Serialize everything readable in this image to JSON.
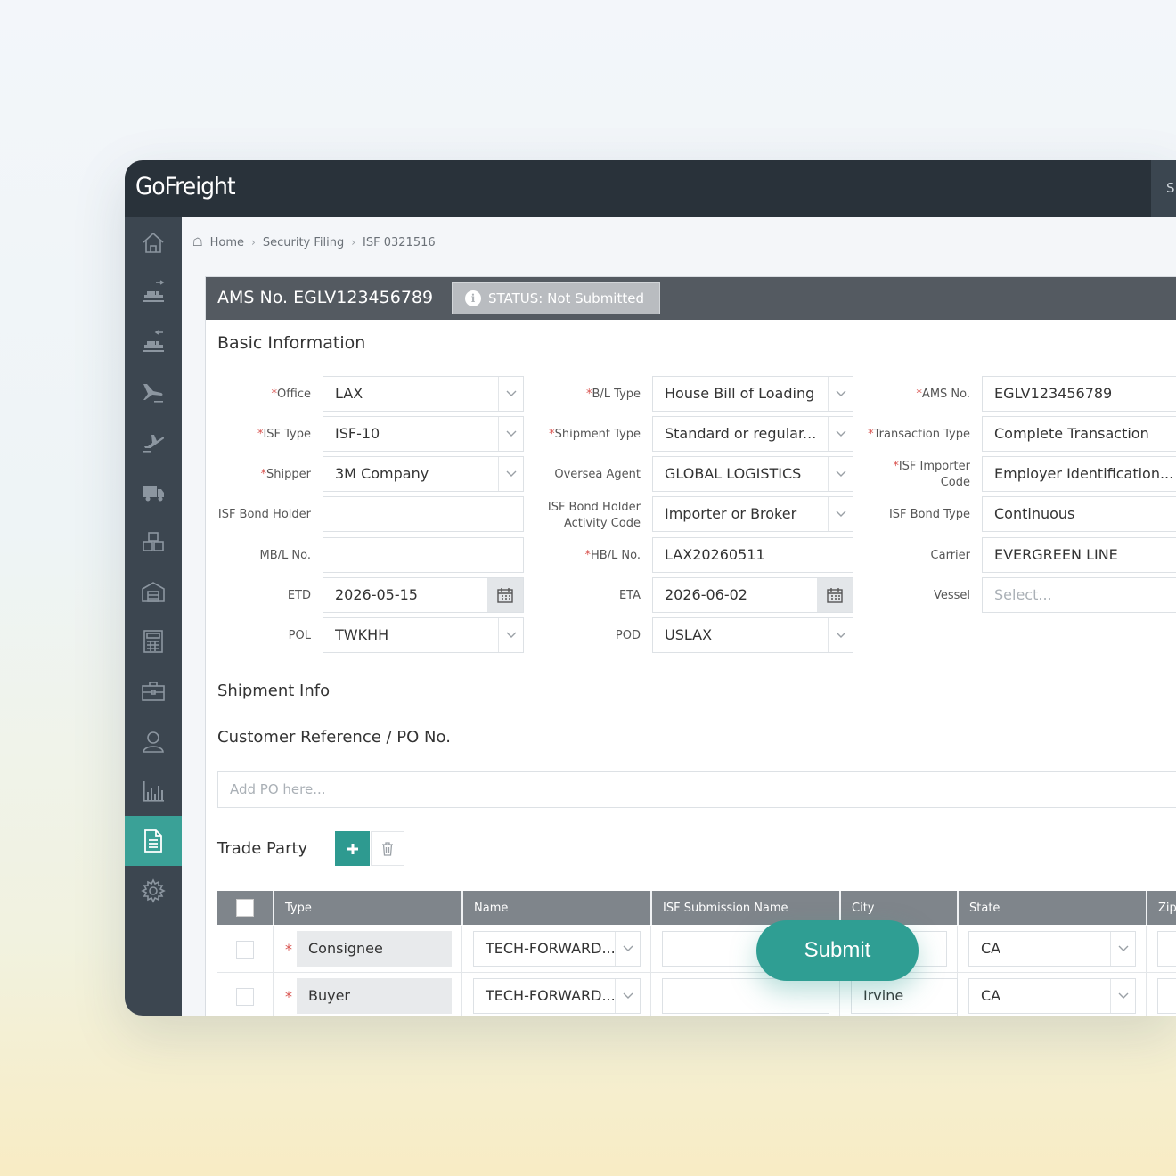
{
  "app": {
    "logo": "GoFreight",
    "topbar_button_partial": "S"
  },
  "sidebar": {
    "items": [
      {
        "icon": "home-icon"
      },
      {
        "icon": "ocean-export-icon"
      },
      {
        "icon": "ocean-import-icon"
      },
      {
        "icon": "air-import-icon"
      },
      {
        "icon": "air-export-icon"
      },
      {
        "icon": "truck-icon"
      },
      {
        "icon": "boxes-icon"
      },
      {
        "icon": "warehouse-icon"
      },
      {
        "icon": "calculator-icon"
      },
      {
        "icon": "briefcase-icon"
      },
      {
        "icon": "contacts-icon"
      },
      {
        "icon": "reports-chart-icon"
      },
      {
        "icon": "document-icon",
        "active": true
      },
      {
        "icon": "settings-gear-icon"
      }
    ]
  },
  "breadcrumb": {
    "home": "Home",
    "section": "Security Filing",
    "current": "ISF 0321516"
  },
  "header": {
    "ams_title": "AMS No. EGLV123456789",
    "status": "STATUS: Not Submitted"
  },
  "basic": {
    "title": "Basic Information",
    "office": {
      "label": "Office",
      "value": "LAX"
    },
    "isf_type": {
      "label": "ISF Type",
      "value": "ISF-10"
    },
    "shipper": {
      "label": "Shipper",
      "value": "3M Company"
    },
    "bond_holder": {
      "label": "ISF Bond Holder",
      "value": ""
    },
    "mbl": {
      "label": "MB/L No.",
      "value": ""
    },
    "etd": {
      "label": "ETD",
      "value": "2026-05-15"
    },
    "pol": {
      "label": "POL",
      "value": "TWKHH"
    },
    "bl_type": {
      "label": "B/L Type",
      "value": "House Bill of Loading"
    },
    "shipment_type": {
      "label": "Shipment Type",
      "value": "Standard or regular..."
    },
    "oversea_agent": {
      "label": "Oversea Agent",
      "value": "GLOBAL LOGISTICS"
    },
    "activity_code": {
      "label_1": "ISF Bond Holder",
      "label_2": "Activity Code",
      "value": "Importer or Broker"
    },
    "hbl": {
      "label": "HB/L No.",
      "value": "LAX20260511"
    },
    "eta": {
      "label": "ETA",
      "value": "2026-06-02"
    },
    "pod": {
      "label": "POD",
      "value": "USLAX"
    },
    "ams_no": {
      "label": "AMS No.",
      "value": "EGLV123456789"
    },
    "transaction_type": {
      "label": "Transaction Type",
      "value": "Complete Transaction"
    },
    "importer_code": {
      "label_1": "ISF Importer",
      "label_2": "Code",
      "value": "Employer Identification..."
    },
    "bond_type": {
      "label": "ISF Bond Type",
      "value": "Continuous"
    },
    "carrier": {
      "label": "Carrier",
      "value": "EVERGREEN LINE"
    },
    "vessel": {
      "label": "Vessel",
      "placeholder": "Select..."
    },
    "required_mark": "*"
  },
  "shipment": {
    "title": "Shipment Info"
  },
  "customer_ref": {
    "title": "Customer Reference / PO No.",
    "placeholder": "Add PO here..."
  },
  "trade_party": {
    "title": "Trade Party",
    "columns": [
      "Type",
      "Name",
      "ISF Submission Name",
      "City",
      "State",
      "Zip"
    ],
    "rows": [
      {
        "type": "Consignee",
        "name": "TECH-FORWARD...",
        "submission_name": "",
        "city": "",
        "state": "CA"
      },
      {
        "type": "Buyer",
        "name": "TECH-FORWARD...",
        "submission_name": "",
        "city": "Irvine",
        "state": "CA"
      }
    ]
  },
  "actions": {
    "submit": "Submit"
  },
  "colors": {
    "accent": "#2f9e93",
    "topbar": "#29323a",
    "sidebar": "#3c4650",
    "required": "#d9534f"
  }
}
